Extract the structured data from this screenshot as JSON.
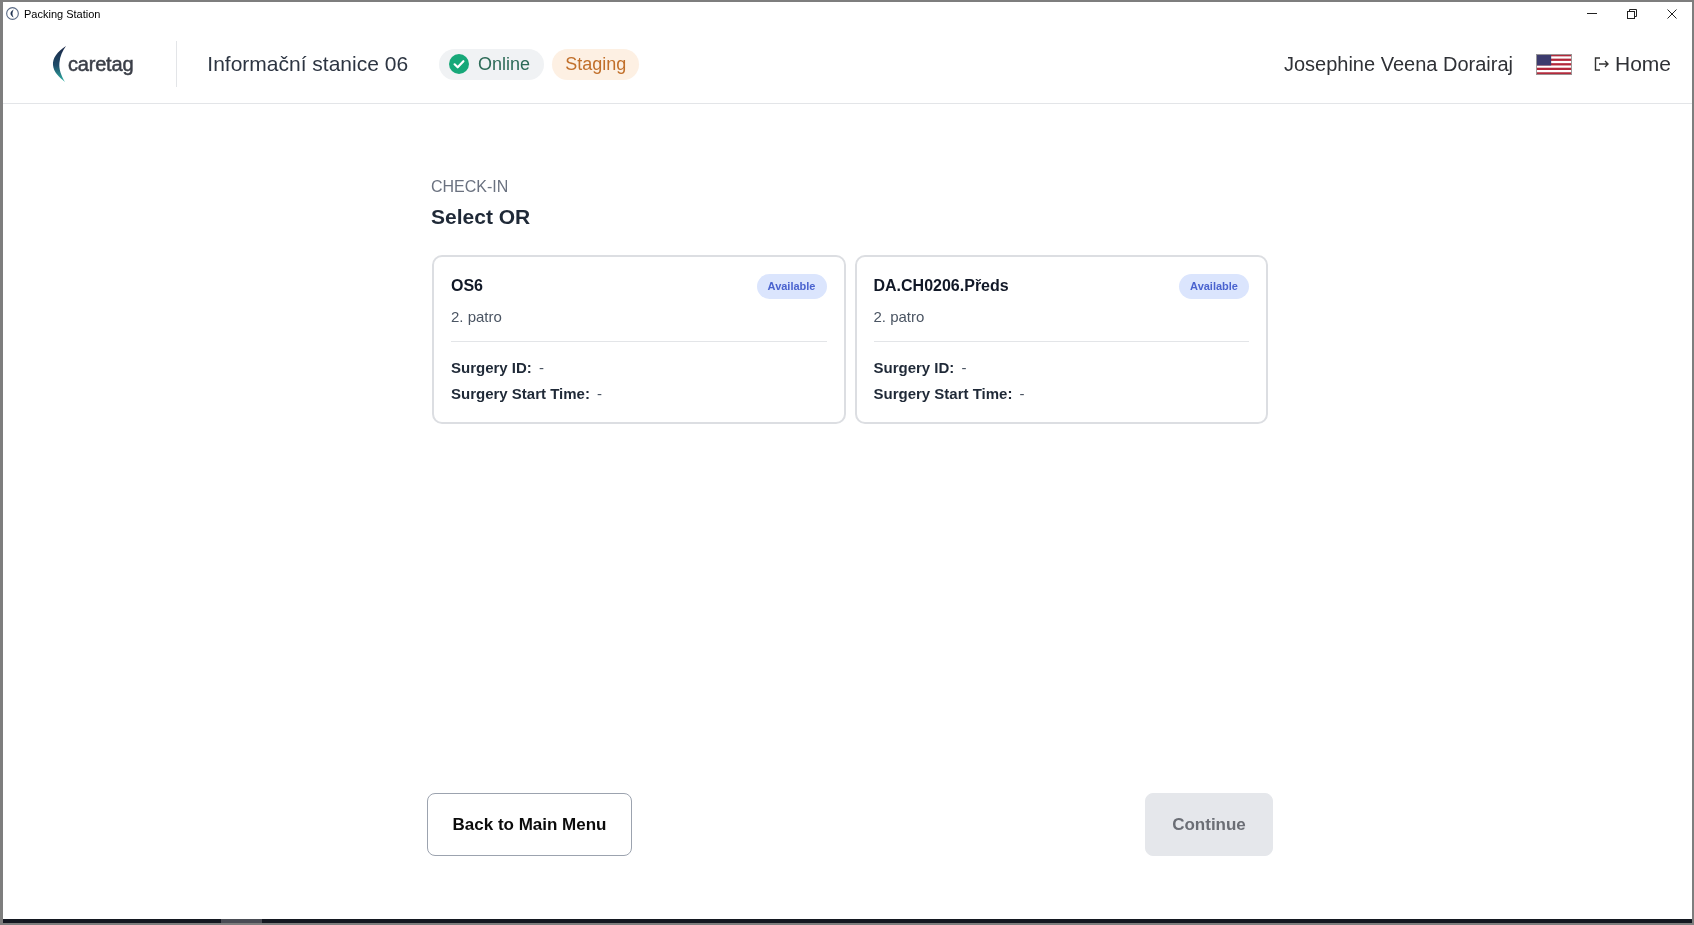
{
  "window": {
    "title": "Packing Station"
  },
  "header": {
    "logo_text": "caretag",
    "station_name": "Informační stanice 06",
    "status_badges": [
      {
        "label": "Online",
        "kind": "online"
      },
      {
        "label": "Staging",
        "kind": "environment"
      }
    ],
    "user_name": "Josephine Veena Dorairaj",
    "home_link": "Home"
  },
  "page": {
    "eyebrow": "CHECK-IN",
    "heading": "Select OR"
  },
  "rooms": [
    {
      "name": "OS6",
      "status": "Available",
      "location": "2. patro",
      "selected": false,
      "details": [
        "**Surgery ID:** -",
        "**Surgery Start Time:** -"
      ]
    },
    {
      "name": "DA.CH0206.Předs",
      "status": "Available",
      "location": "2. patro",
      "selected": false,
      "details": [
        "**Surgery ID:** -",
        "**Surgery Start Time:** -"
      ]
    }
  ],
  "buttons": [
    {
      "label": "Back to Main Menu",
      "kind": "secondary",
      "disabled": false
    },
    {
      "label": "Continue",
      "kind": "primary",
      "disabled": true
    }
  ]
}
